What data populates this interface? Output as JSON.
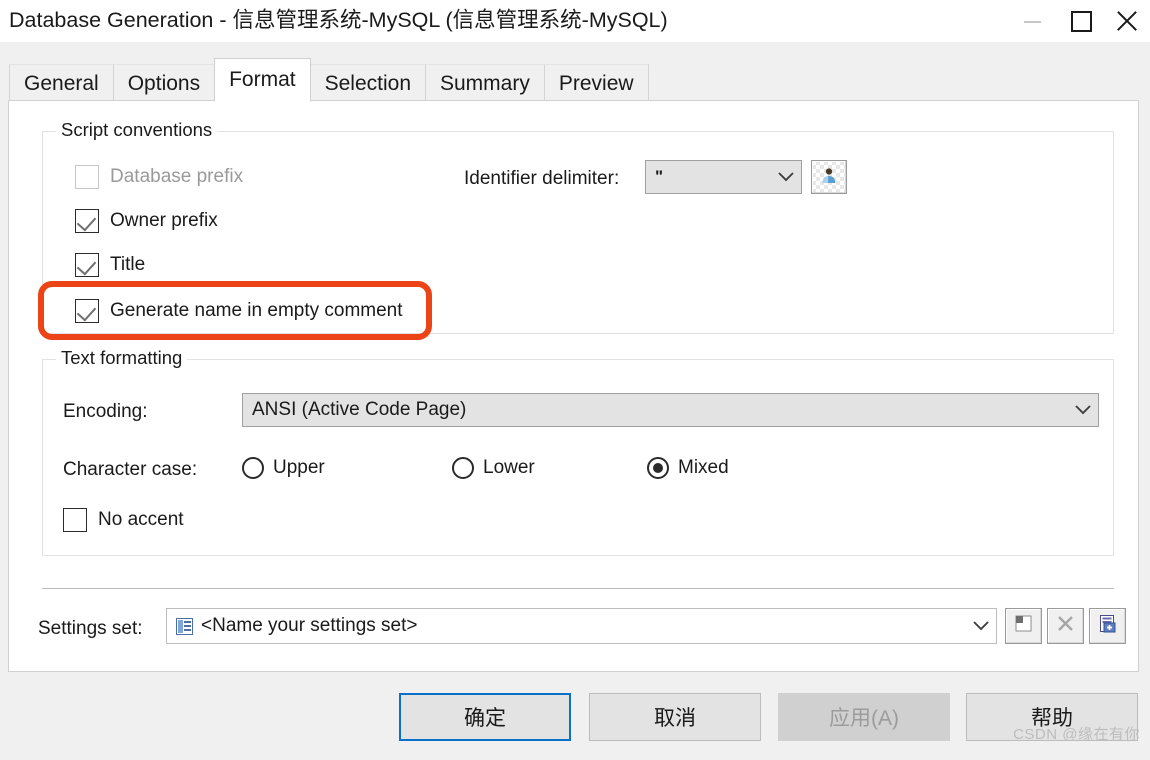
{
  "window": {
    "title": "Database Generation - 信息管理系统-MySQL (信息管理系统-MySQL)",
    "controls": {
      "minimize": "minimize-icon",
      "maximize": "maximize-icon",
      "close": "close-icon"
    }
  },
  "tabs": [
    {
      "label": "General",
      "active": false
    },
    {
      "label": "Options",
      "active": false
    },
    {
      "label": "Format",
      "active": true
    },
    {
      "label": "Selection",
      "active": false
    },
    {
      "label": "Summary",
      "active": false
    },
    {
      "label": "Preview",
      "active": false
    }
  ],
  "script_conventions": {
    "group_title": "Script conventions",
    "checkboxes": [
      {
        "label": "Database prefix",
        "checked": false,
        "disabled": true
      },
      {
        "label": "Owner prefix",
        "checked": true,
        "disabled": false
      },
      {
        "label": "Title",
        "checked": true,
        "disabled": false
      },
      {
        "label": "Generate name in empty comment",
        "checked": true,
        "disabled": false
      }
    ],
    "identifier_delimiter": {
      "label": "Identifier delimiter:",
      "value": "\"",
      "button_icon": "user-icon"
    }
  },
  "text_formatting": {
    "group_title": "Text formatting",
    "encoding": {
      "label": "Encoding:",
      "value": "ANSI (Active Code Page)"
    },
    "character_case": {
      "label": "Character case:",
      "options": [
        {
          "label": "Upper",
          "selected": false
        },
        {
          "label": "Lower",
          "selected": false
        },
        {
          "label": "Mixed",
          "selected": true
        }
      ]
    },
    "no_accent": {
      "label": "No accent",
      "checked": false
    }
  },
  "settings_set": {
    "label": "Settings set:",
    "value": "<Name your settings set>",
    "buttons": [
      {
        "icon": "save-icon",
        "disabled": true
      },
      {
        "icon": "delete-x-icon",
        "disabled": true
      },
      {
        "icon": "new-document-icon",
        "disabled": false
      }
    ]
  },
  "footer": {
    "buttons": [
      {
        "label": "确定",
        "state": "focused"
      },
      {
        "label": "取消",
        "state": "normal"
      },
      {
        "label": "应用(A)",
        "state": "disabled"
      },
      {
        "label": "帮助",
        "state": "normal"
      }
    ],
    "watermark": "CSDN @缘在有你"
  },
  "annotation": {
    "color": "#ec4417",
    "target": "Generate name in empty comment"
  }
}
